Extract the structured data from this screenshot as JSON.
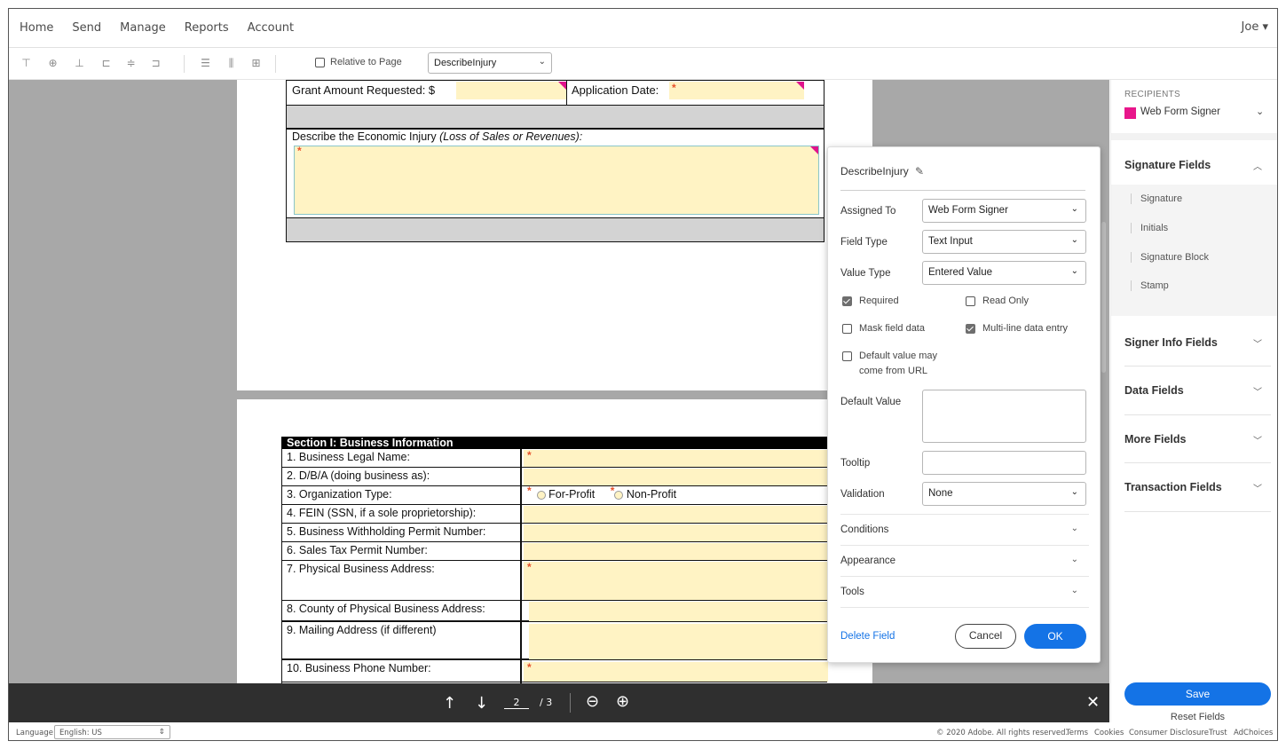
{
  "nav": {
    "items": [
      "Home",
      "Send",
      "Manage",
      "Reports",
      "Account"
    ],
    "user": "Joe ▾"
  },
  "toolbar": {
    "icons": [
      "align-top-icon",
      "align-middle-icon",
      "align-bottom-icon",
      "align-left-icon",
      "align-center-icon",
      "align-right-icon",
      "distribute-horizontal-icon",
      "distribute-vertical-icon",
      "match-size-icon"
    ],
    "relative_to_page": "Relative to Page",
    "field_selector": "DescribeInjury"
  },
  "document": {
    "top_form": {
      "grant_amount_label": "Grant Amount Requested: $",
      "application_date_label": "Application Date:",
      "describe_label": "Describe the Economic Injury",
      "describe_label_italic": "(Loss of Sales or Revenues):"
    },
    "section": {
      "title": "Section I: Business Information",
      "rows": [
        "1.  Business Legal Name:",
        "2.  D/B/A (doing business as):",
        "3.  Organization Type:",
        "4.  FEIN (SSN, if a sole proprietorship):",
        "5.  Business Withholding Permit Number:",
        "6.  Sales Tax Permit Number:",
        "7.  Physical Business Address:",
        "8.  County of Physical Business Address:",
        "9.  Mailing Address (if different)",
        "10. Business Phone Number:"
      ],
      "org_options": [
        "For-Profit",
        "Non-Profit"
      ]
    }
  },
  "pager": {
    "current_page": "2",
    "total_pages": "/ 3"
  },
  "field_panel": {
    "field_name": "DescribeInjury",
    "assigned_to_label": "Assigned To",
    "assigned_to_value": "Web Form Signer",
    "field_type_label": "Field Type",
    "field_type_value": "Text Input",
    "value_type_label": "Value Type",
    "value_type_value": "Entered Value",
    "required_label": "Required",
    "read_only_label": "Read Only",
    "mask_label": "Mask field data",
    "multiline_label": "Multi-line data entry",
    "default_url_label_1": "Default value may",
    "default_url_label_2": "come from URL",
    "default_value_label": "Default Value",
    "tooltip_label": "Tooltip",
    "validation_label": "Validation",
    "validation_value": "None",
    "conditions_label": "Conditions",
    "appearance_label": "Appearance",
    "tools_label": "Tools",
    "delete_label": "Delete Field",
    "cancel_label": "Cancel",
    "ok_label": "OK",
    "checkbox_states": {
      "required": true,
      "read_only": false,
      "mask": false,
      "multiline": true,
      "default_url": false
    }
  },
  "right_panel": {
    "recipients_label": "RECIPIENTS",
    "recipient_name": "Web Form Signer",
    "recipient_color": "#e8168b",
    "signature_fields": "Signature Fields",
    "signature_items": [
      "Signature",
      "Initials",
      "Signature Block",
      "Stamp"
    ],
    "signer_info_fields": "Signer Info Fields",
    "data_fields": "Data Fields",
    "more_fields": "More Fields",
    "transaction_fields": "Transaction Fields",
    "save_label": "Save",
    "reset_label": "Reset Fields"
  },
  "footer": {
    "language_label": "Language",
    "language_value": "English: US",
    "copyright": "© 2020 Adobe. All rights reserved.",
    "links": [
      "Terms",
      "Cookies",
      "Consumer Disclosure",
      "Trust",
      "AdChoices"
    ]
  },
  "colors": {
    "accent_blue": "#1473e6",
    "field_yellow": "#fff3c4",
    "required_marker": "#e8522b",
    "field_corner": "#e0138c"
  }
}
